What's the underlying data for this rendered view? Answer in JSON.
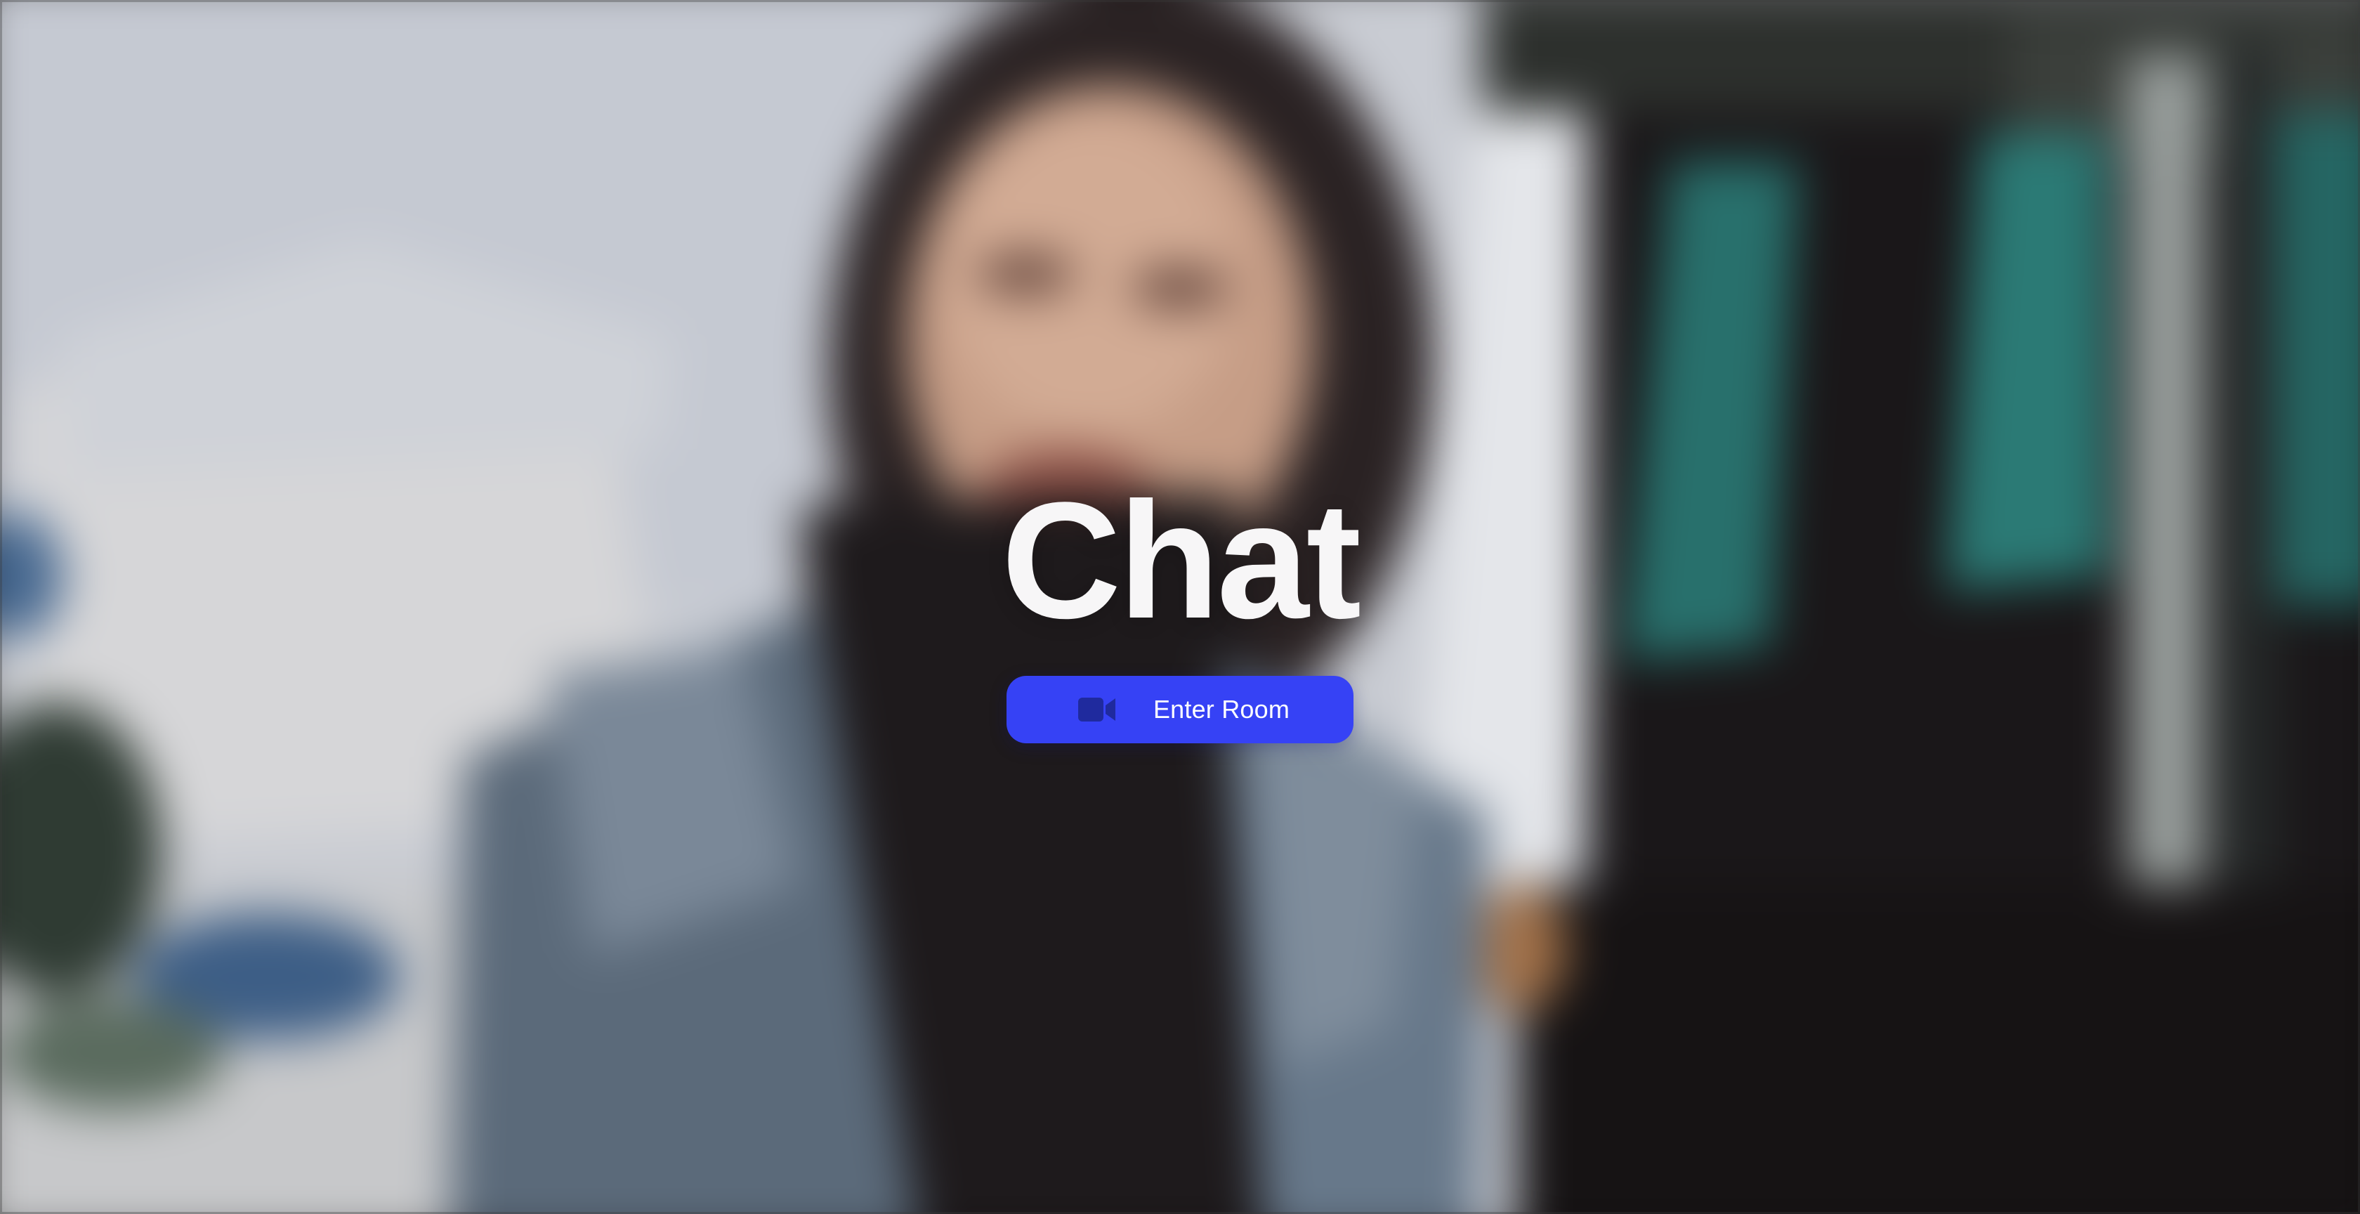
{
  "app": {
    "title": "Chat"
  },
  "cta": {
    "label": "Enter Room",
    "icon": "video-camera-icon"
  },
  "colors": {
    "button_bg": "#3642f5",
    "button_icon": "#1f2a9e",
    "title_text": "#f7f6f7"
  },
  "background": {
    "description_icon": "blurred-photo-background"
  }
}
